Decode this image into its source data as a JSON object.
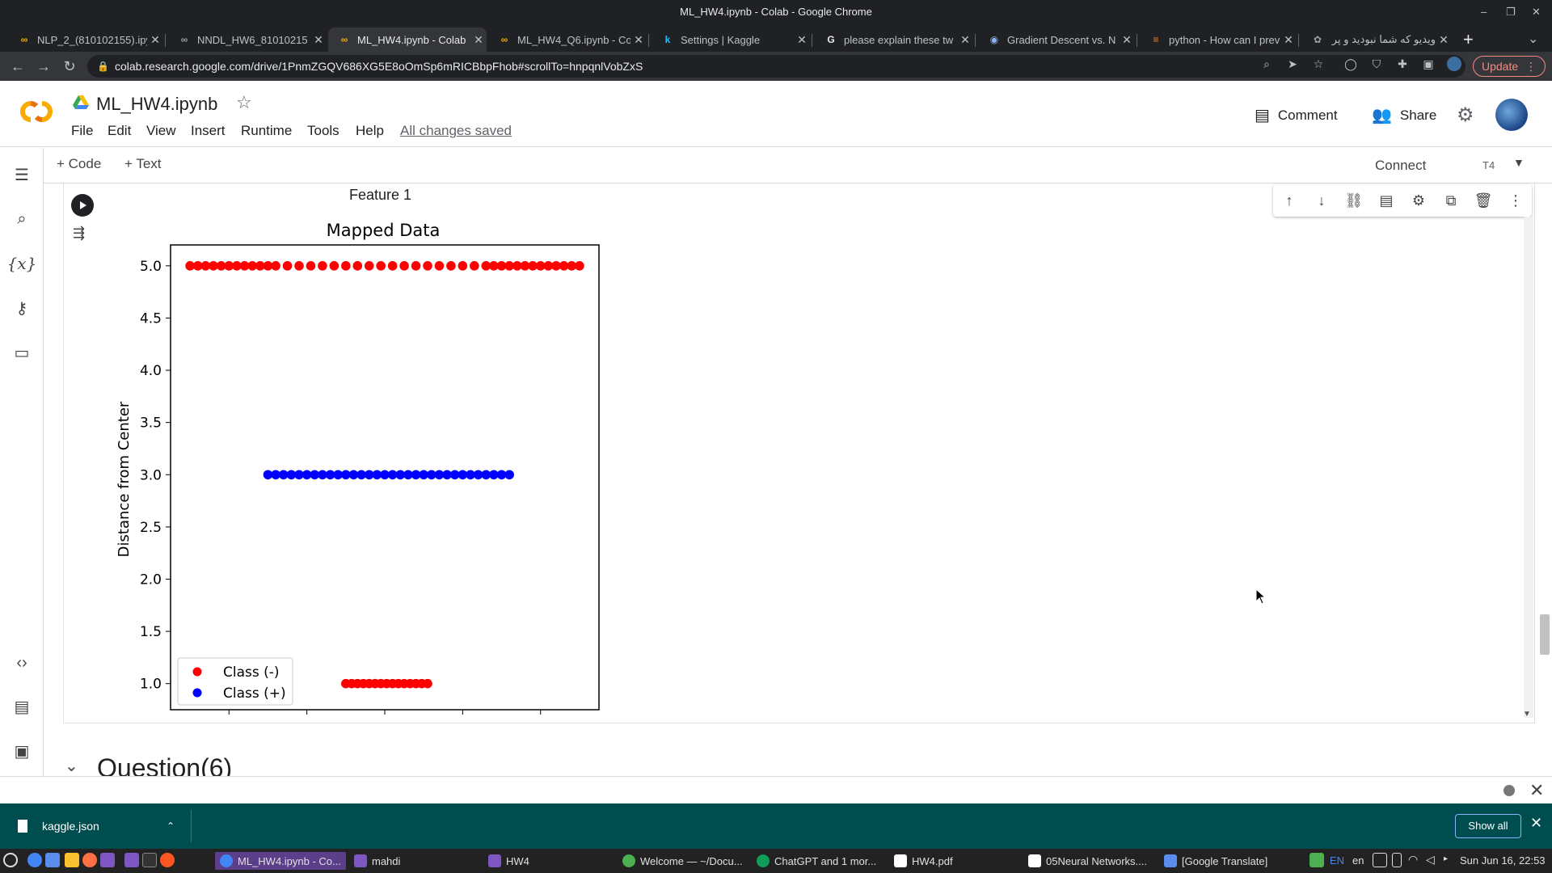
{
  "window": {
    "title": "ML_HW4.ipynb - Colab - Google Chrome"
  },
  "tabs": [
    {
      "label": "NLP_2_(810102155).ipy",
      "icon": "colab-icon",
      "active": false
    },
    {
      "label": "NNDL_HW6_81010215",
      "icon": "colab-icon",
      "active": false
    },
    {
      "label": "ML_HW4.ipynb - Colab",
      "icon": "colab-icon",
      "active": true
    },
    {
      "label": "ML_HW4_Q6.ipynb - Co",
      "icon": "colab-icon",
      "active": false
    },
    {
      "label": "Settings | Kaggle",
      "icon": "kaggle-icon",
      "active": false
    },
    {
      "label": "please explain these tw",
      "icon": "google-icon",
      "active": false
    },
    {
      "label": "Gradient Descent vs. N",
      "icon": "site-icon",
      "active": false
    },
    {
      "label": "python - How can I prev",
      "icon": "stackoverflow-icon",
      "active": false
    },
    {
      "label": "ویدیو که شما نبودید و پر",
      "icon": "site-icon",
      "active": false
    }
  ],
  "address": {
    "url": "colab.research.google.com/drive/1PnmZGQV686XG5E8oOmSp6mRICBbpFhob#scrollTo=hnpqnlVobZxS"
  },
  "browser": {
    "update_label": "Update"
  },
  "colab": {
    "notebook_title": "ML_HW4.ipynb",
    "menu": [
      "File",
      "Edit",
      "View",
      "Insert",
      "Runtime",
      "Tools",
      "Help"
    ],
    "saved_status": "All changes saved",
    "comment_label": "Comment",
    "share_label": "Share",
    "add_code": "Code",
    "add_text": "Text",
    "connect_label": "Connect",
    "runtime_badge": "T4"
  },
  "cell": {
    "prev_label": "Feature 1",
    "next_section": "Question(6)"
  },
  "chart_data": {
    "type": "scatter",
    "title": "Mapped Data",
    "xlabel": "",
    "ylabel": "Distance from Center",
    "ylim": [
      0.75,
      5.2
    ],
    "yticks": [
      1.0,
      1.5,
      2.0,
      2.5,
      3.0,
      3.5,
      4.0,
      4.5,
      5.0
    ],
    "xlim": [
      -5.5,
      5.5
    ],
    "legend_position": "lower-left",
    "series": [
      {
        "name": "Class (-)",
        "color": "#ff0000",
        "points": [
          [
            -5.0,
            5
          ],
          [
            -4.8,
            5
          ],
          [
            -4.6,
            5
          ],
          [
            -4.4,
            5
          ],
          [
            -4.2,
            5
          ],
          [
            -4.0,
            5
          ],
          [
            -3.8,
            5
          ],
          [
            -3.6,
            5
          ],
          [
            -3.4,
            5
          ],
          [
            -3.2,
            5
          ],
          [
            -3.0,
            5
          ],
          [
            -2.8,
            5
          ],
          [
            -2.5,
            5
          ],
          [
            -2.2,
            5
          ],
          [
            -1.9,
            5
          ],
          [
            -1.6,
            5
          ],
          [
            -1.3,
            5
          ],
          [
            -1.0,
            5
          ],
          [
            -0.7,
            5
          ],
          [
            -0.4,
            5
          ],
          [
            -0.1,
            5
          ],
          [
            0.2,
            5
          ],
          [
            0.5,
            5
          ],
          [
            0.8,
            5
          ],
          [
            1.1,
            5
          ],
          [
            1.4,
            5
          ],
          [
            1.7,
            5
          ],
          [
            2.0,
            5
          ],
          [
            2.3,
            5
          ],
          [
            2.6,
            5
          ],
          [
            2.8,
            5
          ],
          [
            3.0,
            5
          ],
          [
            3.2,
            5
          ],
          [
            3.4,
            5
          ],
          [
            3.6,
            5
          ],
          [
            3.8,
            5
          ],
          [
            4.0,
            5
          ],
          [
            4.2,
            5
          ],
          [
            4.4,
            5
          ],
          [
            4.6,
            5
          ],
          [
            4.8,
            5
          ],
          [
            5.0,
            5
          ],
          [
            -1.0,
            1
          ],
          [
            -0.85,
            1
          ],
          [
            -0.7,
            1
          ],
          [
            -0.55,
            1
          ],
          [
            -0.4,
            1
          ],
          [
            -0.25,
            1
          ],
          [
            -0.1,
            1
          ],
          [
            0.05,
            1
          ],
          [
            0.2,
            1
          ],
          [
            0.35,
            1
          ],
          [
            0.5,
            1
          ],
          [
            0.65,
            1
          ],
          [
            0.8,
            1
          ],
          [
            0.95,
            1
          ],
          [
            1.1,
            1
          ]
        ]
      },
      {
        "name": "Class (+)",
        "color": "#0000ff",
        "points": [
          [
            -3.0,
            3
          ],
          [
            -2.8,
            3
          ],
          [
            -2.6,
            3
          ],
          [
            -2.4,
            3
          ],
          [
            -2.2,
            3
          ],
          [
            -2.0,
            3
          ],
          [
            -1.8,
            3
          ],
          [
            -1.6,
            3
          ],
          [
            -1.4,
            3
          ],
          [
            -1.2,
            3
          ],
          [
            -1.0,
            3
          ],
          [
            -0.8,
            3
          ],
          [
            -0.6,
            3
          ],
          [
            -0.4,
            3
          ],
          [
            -0.2,
            3
          ],
          [
            0.0,
            3
          ],
          [
            0.2,
            3
          ],
          [
            0.4,
            3
          ],
          [
            0.6,
            3
          ],
          [
            0.8,
            3
          ],
          [
            1.0,
            3
          ],
          [
            1.2,
            3
          ],
          [
            1.4,
            3
          ],
          [
            1.6,
            3
          ],
          [
            1.8,
            3
          ],
          [
            2.0,
            3
          ],
          [
            2.2,
            3
          ],
          [
            2.4,
            3
          ],
          [
            2.6,
            3
          ],
          [
            2.8,
            3
          ],
          [
            3.0,
            3
          ],
          [
            3.2,
            3
          ]
        ]
      }
    ]
  },
  "download_shelf": {
    "file_name": "kaggle.json",
    "show_all_label": "Show all"
  },
  "taskbar": {
    "items": [
      "ML_HW4.ipynb - Co...",
      "mahdi",
      "HW4",
      "Welcome — ~/Docu...",
      "ChatGPT and 1 mor...",
      "HW4.pdf",
      "05Neural Networks....",
      "[Google Translate]"
    ],
    "lang1": "EN",
    "lang2": "en",
    "clock": "Sun Jun 16, 22:53"
  }
}
